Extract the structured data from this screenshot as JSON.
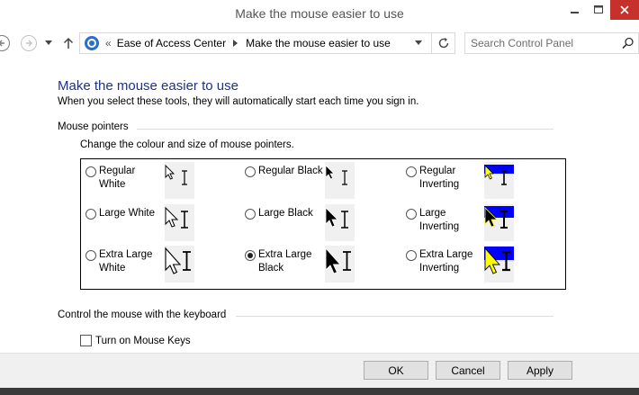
{
  "window": {
    "title": "Make the mouse easier to use"
  },
  "nav": {
    "breadcrumb": [
      {
        "label": "Ease of Access Center"
      },
      {
        "label": "Make the mouse easier to use"
      }
    ],
    "breadcrumb_overflow": "«",
    "search_placeholder": "Search Control Panel"
  },
  "main": {
    "title": "Make the mouse easier to use",
    "subtitle": "When you select these tools, they will automatically start each time you sign in.",
    "pointers_group": {
      "title": "Mouse pointers",
      "description": "Change the colour and size of mouse pointers.",
      "options": [
        {
          "label": "Regular White",
          "checked": false
        },
        {
          "label": "Regular Black",
          "checked": false
        },
        {
          "label": "Regular Inverting",
          "checked": false
        },
        {
          "label": "Large White",
          "checked": false
        },
        {
          "label": "Large Black",
          "checked": false
        },
        {
          "label": "Large Inverting",
          "checked": false
        },
        {
          "label": "Extra Large White",
          "checked": false
        },
        {
          "label": "Extra Large Black",
          "checked": true
        },
        {
          "label": "Extra Large Inverting",
          "checked": false
        }
      ]
    },
    "keyboard_group": {
      "title": "Control the mouse with the keyboard",
      "mouse_keys_label": "Turn on Mouse Keys",
      "mouse_keys_checked": false
    }
  },
  "footer": {
    "ok_label": "OK",
    "cancel_label": "Cancel",
    "apply_label": "Apply"
  },
  "colors": {
    "title_blue": "#1e3287",
    "close_red": "#c7312b",
    "inverting_blue": "#0000ff",
    "inverting_yellow": "#ffff00"
  }
}
